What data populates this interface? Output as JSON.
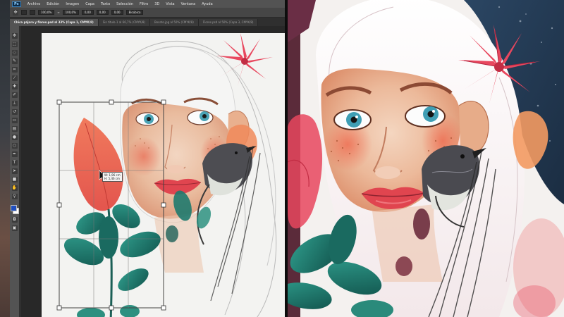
{
  "photoshop": {
    "logo": "Ps",
    "menu": [
      "Archivo",
      "Edición",
      "Imagen",
      "Capa",
      "Texto",
      "Selección",
      "Filtro",
      "3D",
      "Vista",
      "Ventana",
      "Ayuda"
    ],
    "options": {
      "x_value": "",
      "y_value": "",
      "w_value": "100,0%",
      "h_value": "100,0%",
      "angle_value": "0,00",
      "h_skew_value": "0,00",
      "v_skew_value": "0,00",
      "interpolation_value": "Bicúbica"
    },
    "tabs": [
      {
        "label": "Chica pájaro y flores.psd al 33% (Capa 1, CMYK/8)",
        "active": true
      },
      {
        "label": "Sin título-1 al 66,7% (CMYK/8)",
        "active": false
      },
      {
        "label": "Boceto.jpg al 50% (CMYK/8)",
        "active": false
      },
      {
        "label": "Flores.psd al 50% (Capa 3, CMYK/8)",
        "active": false
      }
    ],
    "transform_tooltip": {
      "line1": "W: 1,96 cm",
      "line2": "H: 5,46 cm"
    },
    "swatches": {
      "foreground": "#1f4fbf",
      "background": "#ffffff"
    },
    "ui_colors": {
      "menubar": "#535353",
      "panel": "#535353",
      "workspace": "#282828"
    }
  },
  "artwork_palette": {
    "lips": "#e0454f",
    "teal_leaves": "#1f7a6e",
    "pink_flower": "#e8475e",
    "sky": "#22384f",
    "skin": "#e9b898"
  }
}
